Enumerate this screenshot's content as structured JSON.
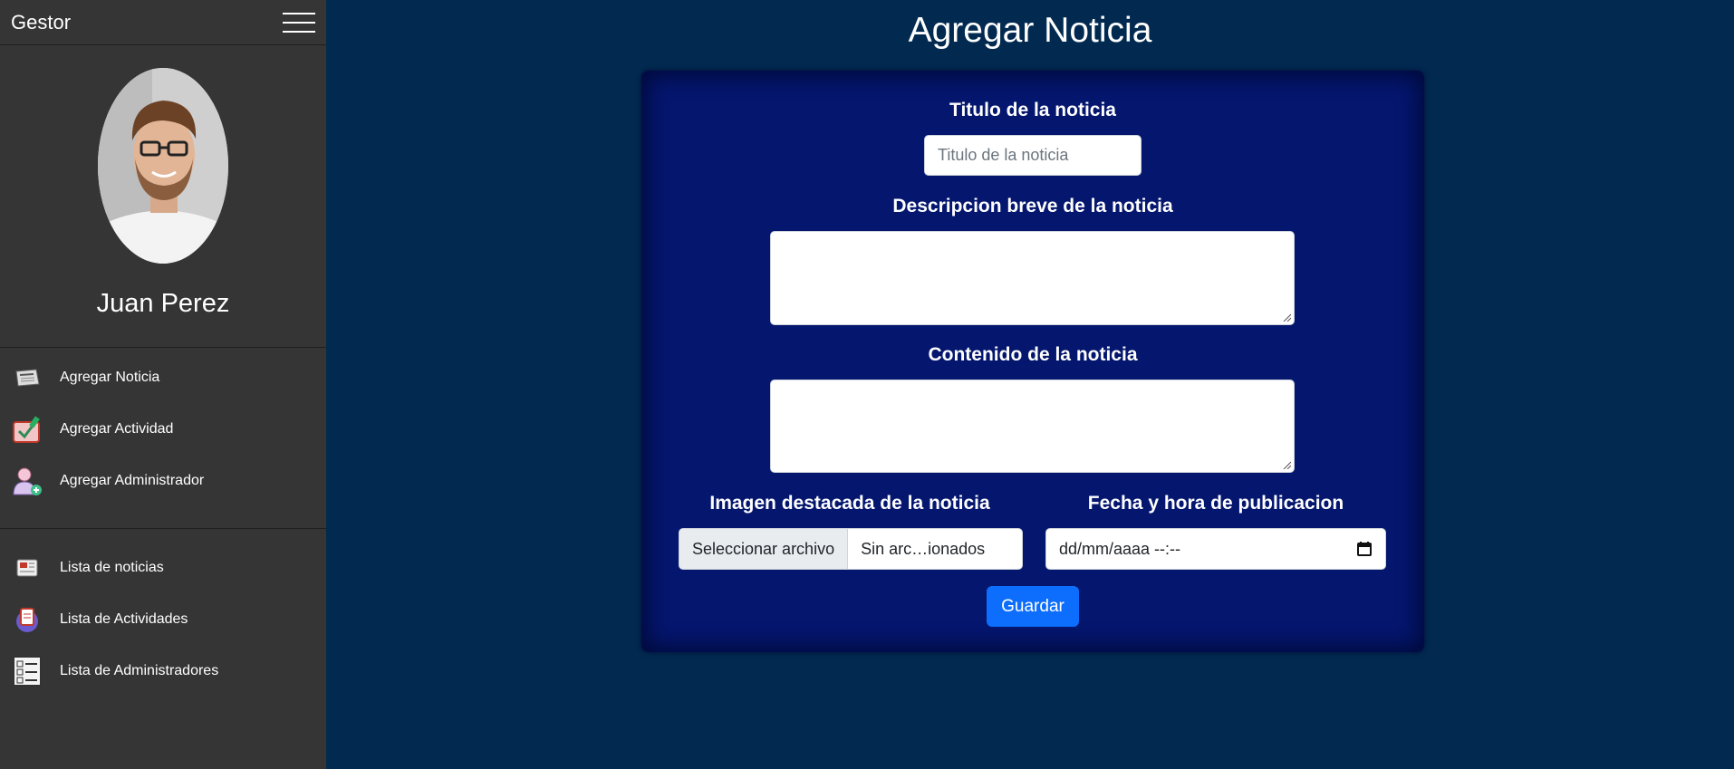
{
  "sidebar": {
    "brand": "Gestor",
    "user_name": "Juan Perez",
    "menu_primary": [
      {
        "label": "Agregar Noticia",
        "icon": "newspaper-icon"
      },
      {
        "label": "Agregar Actividad",
        "icon": "activity-add-icon"
      },
      {
        "label": "Agregar Administrador",
        "icon": "admin-add-icon"
      }
    ],
    "menu_secondary": [
      {
        "label": "Lista de noticias",
        "icon": "news-list-icon"
      },
      {
        "label": "Lista de Actividades",
        "icon": "activities-list-icon"
      },
      {
        "label": "Lista de Administradores",
        "icon": "admins-list-icon"
      }
    ]
  },
  "main": {
    "title": "Agregar Noticia",
    "form": {
      "title_label": "Titulo de la noticia",
      "title_placeholder": "Titulo de la noticia",
      "title_value": "",
      "summary_label": "Descripcion breve de la noticia",
      "summary_value": "",
      "content_label": "Contenido de la noticia",
      "content_value": "",
      "image_label": "Imagen destacada de la noticia",
      "file_button": "Seleccionar archivo",
      "file_status": "Sin arc…ionados",
      "date_label": "Fecha y hora de publicacion",
      "date_placeholder": "dd/mm/aaaa --:--",
      "save_label": "Guardar"
    }
  },
  "colors": {
    "background": "#022a50",
    "sidebar": "#353535",
    "card": "#04166e",
    "primary_button": "#0d6efd"
  }
}
